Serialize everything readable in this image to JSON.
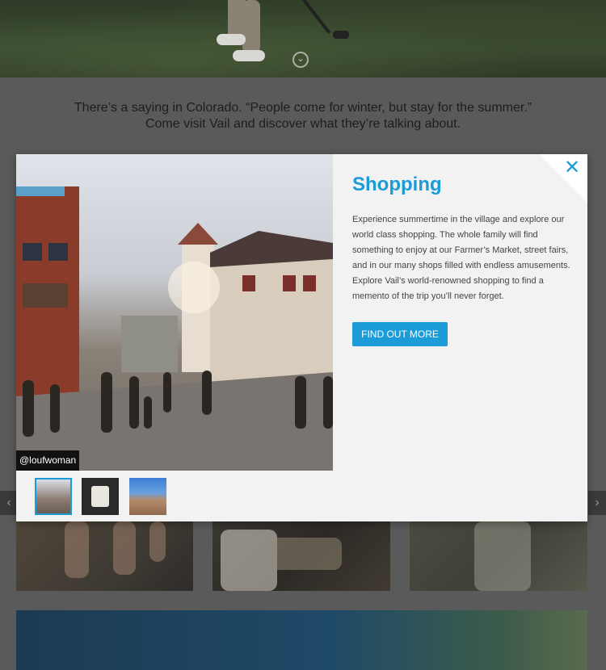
{
  "hero": {
    "scroll_icon": "chevron-down-circle-icon",
    "scroll_glyph": "⌄"
  },
  "intro": {
    "line1": "There’s a saying in Colorado. “People come for winter, but stay for the summer.”",
    "line2": "Come visit Vail and discover what they’re talking about."
  },
  "modal": {
    "title": "Shopping",
    "body": "Experience summertime in the village and explore our world class shopping. The whole family will find something to enjoy at our Farmer’s Market, street fairs, and in our many shops filled with endless amusements. Explore Vail’s world-renowned shopping to find a memento of the trip you’ll never forget.",
    "cta_label": "FIND OUT MORE",
    "close_glyph": "✕",
    "photo_credit": "@loufwoman",
    "thumbnails": [
      {
        "name": "village-street",
        "active": true
      },
      {
        "name": "cake",
        "active": false
      },
      {
        "name": "village-buildings",
        "active": false
      }
    ],
    "accent_color": "#1b9bd8"
  },
  "carousel": {
    "prev_glyph": "‹",
    "next_glyph": "›"
  }
}
